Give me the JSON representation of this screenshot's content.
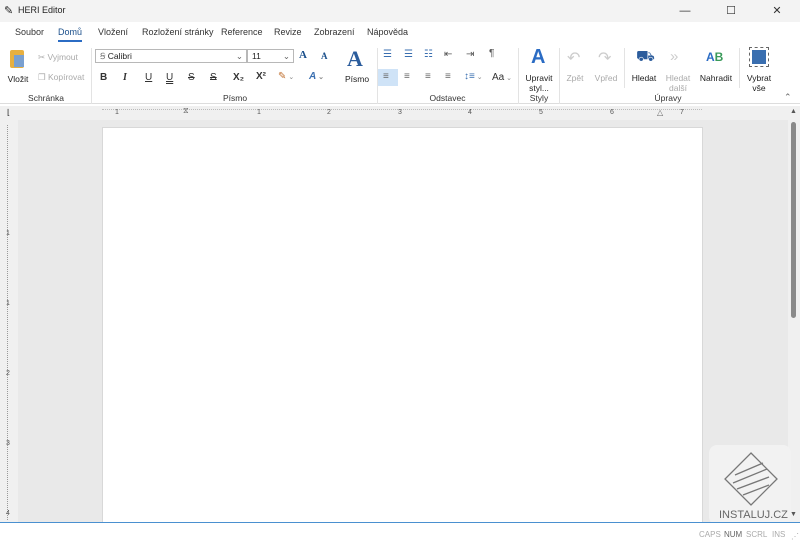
{
  "app": {
    "title": "HERI Editor"
  },
  "window": {
    "minimize": "—",
    "maximize": "☐",
    "close": "✕"
  },
  "tabs": [
    {
      "label": "Soubor"
    },
    {
      "label": "Domů",
      "active": true
    },
    {
      "label": "Vložení"
    },
    {
      "label": "Rozložení stránky"
    },
    {
      "label": "Reference"
    },
    {
      "label": "Revize"
    },
    {
      "label": "Zobrazení"
    },
    {
      "label": "Nápověda"
    }
  ],
  "clipboard": {
    "paste": "Vložit",
    "cut": "Vyjmout",
    "copy": "Kopírovat",
    "group": "Schránka"
  },
  "font": {
    "name": "Calibri",
    "size": "11",
    "bold": "B",
    "italic": "I",
    "underline": "U",
    "double_underline": "U",
    "strike": "S",
    "double_strike": "S",
    "subscript": "X₂",
    "superscript": "X²",
    "font_button": "Písmo",
    "group": "Písmo",
    "grow": "A",
    "shrink": "A"
  },
  "paragraph": {
    "group": "Odstavec",
    "case": "Aa",
    "pilcrow": "¶"
  },
  "styles": {
    "edit": "Upravit styl...",
    "group": "Styly"
  },
  "editing": {
    "undo": "Zpět",
    "redo": "Vpřed",
    "find": "Hledat",
    "find_next": "Hledat další",
    "replace": "Nahradit",
    "select_all": "Vybrat vše",
    "group": "Úpravy"
  },
  "ruler": {
    "numbers": [
      "1",
      "1",
      "2",
      "3",
      "4",
      "5",
      "6",
      "7"
    ]
  },
  "vruler": {
    "numbers": [
      "1",
      "1",
      "2",
      "3",
      "4"
    ]
  },
  "status": {
    "caps": "CAPS",
    "num": "NUM",
    "scrl": "SCRL",
    "ins": "INS"
  },
  "watermark": "INSTALUJ.CZ",
  "colors": {
    "accent": "#2b6cc4",
    "icon_blue": "#3a6fb0"
  }
}
